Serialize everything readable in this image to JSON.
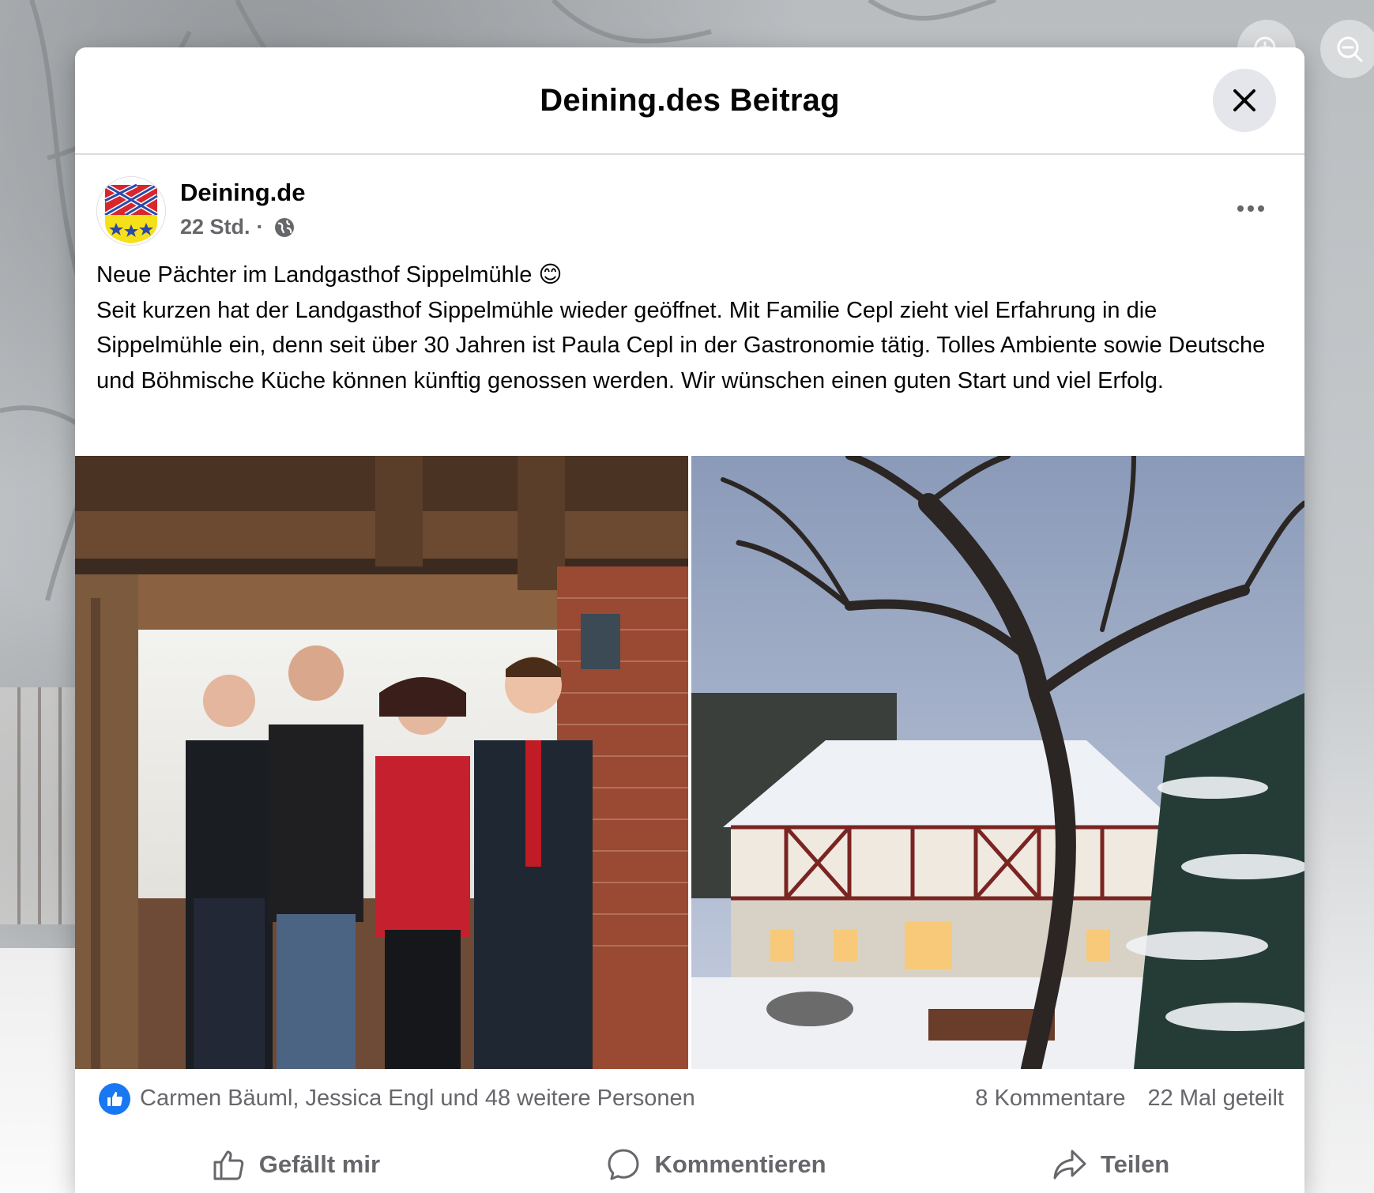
{
  "modal": {
    "title": "Deining.des Beitrag",
    "close_label": "Schließen"
  },
  "post": {
    "page_name": "Deining.de",
    "time": "22 Std.",
    "separator": "·",
    "text_lines": [
      "Neue Pächter im Landgasthof Sippelmühle 😊",
      "Seit kurzen hat der Landgasthof Sippelmühle wieder geöffnet. Mit Familie Cepl zieht viel Erfahrung in die Sippelmühle ein, denn seit über 30 Jahren ist Paula Cepl in der Gastronomie tätig. Tolles Ambiente sowie Deutsche und Böhmische Küche können künftig genossen werden. Wir wünschen einen guten Start und viel Erfolg."
    ]
  },
  "reactions": {
    "text": "Carmen Bäuml, Jessica Engl und 48 weitere Personen",
    "comments": "8 Kommentare",
    "shares": "22 Mal geteilt"
  },
  "actions": {
    "like": "Gefällt mir",
    "comment": "Kommentieren",
    "share": "Teilen"
  },
  "icons": [
    "zoom-in-icon",
    "zoom-out-icon",
    "close-icon",
    "globe-icon",
    "more-icon",
    "like-icon",
    "comment-icon",
    "share-icon"
  ],
  "colors": {
    "accent": "#1877f2",
    "secondary_text": "#65676b"
  }
}
